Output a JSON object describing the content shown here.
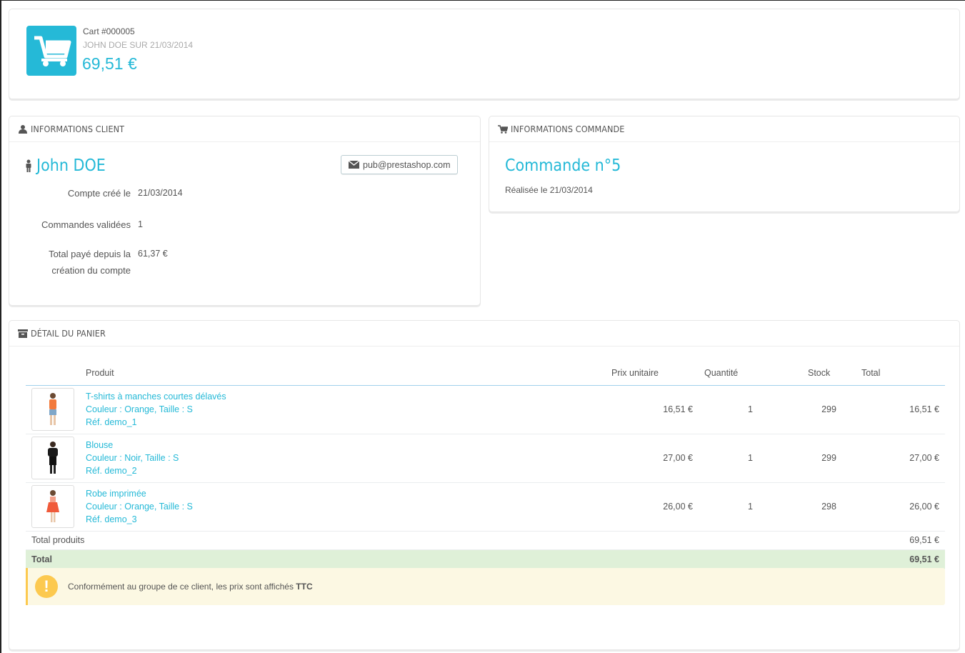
{
  "header": {
    "cart_title": "Cart #000005",
    "cart_subtitle": "JOHN DOE SUR 21/03/2014",
    "cart_total": "69,51 €"
  },
  "client": {
    "heading": "INFORMATIONS CLIENT",
    "name": "John DOE",
    "email": "pub@prestashop.com",
    "account_created_label": "Compte créé le",
    "account_created_value": "21/03/2014",
    "orders_validated_label": "Commandes validées",
    "orders_validated_value": "1",
    "total_paid_label_line1": "Total payé depuis la",
    "total_paid_label_line2": "création du compte",
    "total_paid_value": "61,37 €"
  },
  "order": {
    "heading": "INFORMATIONS COMMANDE",
    "title": "Commande n°5",
    "date": "Réalisée le 21/03/2014"
  },
  "cart_detail": {
    "heading": "DÉTAIL DU PANIER",
    "columns": {
      "product": "Produit",
      "unit_price": "Prix unitaire",
      "quantity": "Quantité",
      "stock": "Stock",
      "total": "Total"
    },
    "rows": [
      {
        "name": "T-shirts à manches courtes délavés",
        "attributes": "Couleur : Orange, Taille : S",
        "ref": "Réf. demo_1",
        "unit_price": "16,51 €",
        "quantity": "1",
        "stock": "299",
        "total": "16,51 €"
      },
      {
        "name": "Blouse",
        "attributes": "Couleur : Noir, Taille : S",
        "ref": "Réf. demo_2",
        "unit_price": "27,00 €",
        "quantity": "1",
        "stock": "299",
        "total": "27,00 €"
      },
      {
        "name": "Robe imprimée",
        "attributes": "Couleur : Orange, Taille : S",
        "ref": "Réf. demo_3",
        "unit_price": "26,00 €",
        "quantity": "1",
        "stock": "298",
        "total": "26,00 €"
      }
    ],
    "total_products_label": "Total produits",
    "total_products_value": "69,51 €",
    "total_label": "Total",
    "total_value": "69,51 €",
    "notice_text": "Conformément au groupe de ce client, les prix sont affichés",
    "notice_bold": "TTC"
  },
  "colors": {
    "accent": "#25b9d7",
    "total_row_bg": "#dff0d8",
    "alert_bg": "#fcf8e3",
    "alert_icon": "#fcc94f"
  }
}
